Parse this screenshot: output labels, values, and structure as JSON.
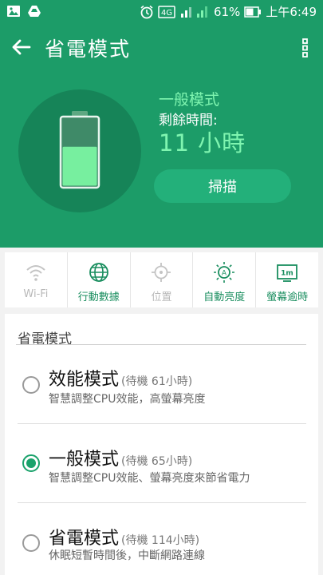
{
  "status_bar": {
    "signal_type": "4G",
    "battery_percent": "61%",
    "time": "上午6:49",
    "icons": [
      "image-icon",
      "drive-icon",
      "alarm-icon",
      "lte-icon",
      "signal-icon",
      "battery-icon"
    ]
  },
  "header": {
    "title": "省電模式",
    "mode_label": "一般模式",
    "remaining_label": "剩餘時間:",
    "remaining_value": "11 小時",
    "scan_button": "掃描",
    "battery_level": 0.58
  },
  "toggles": [
    {
      "label": "Wi-Fi",
      "icon": "wifi-icon",
      "enabled": false
    },
    {
      "label": "行動數據",
      "icon": "globe-icon",
      "enabled": true
    },
    {
      "label": "位置",
      "icon": "location-icon",
      "enabled": false
    },
    {
      "label": "自動亮度",
      "icon": "auto-brightness-icon",
      "enabled": true
    },
    {
      "label": "螢幕逾時",
      "icon": "screen-timeout-icon",
      "enabled": true,
      "badge": "1m"
    }
  ],
  "modes_section": {
    "title": "省電模式",
    "options": [
      {
        "name": "效能模式",
        "standby": "(待機 61小時)",
        "description": "智慧調整CPU效能，高螢幕亮度",
        "selected": false
      },
      {
        "name": "一般模式",
        "standby": "(待機 65小時)",
        "description": "智慧調整CPU效能、螢幕亮度來節省電力",
        "selected": true
      },
      {
        "name": "省電模式",
        "standby": "(待機 114小時)",
        "description": "休眠短暫時間後，中斷網路連線",
        "selected": false
      }
    ]
  },
  "colors": {
    "header_green": "#1c9c68",
    "accent_light_green": "#7ff5b0",
    "scan_button": "#23b07a",
    "toggle_on": "#1a8e5f",
    "toggle_off": "#b9b9b9"
  }
}
